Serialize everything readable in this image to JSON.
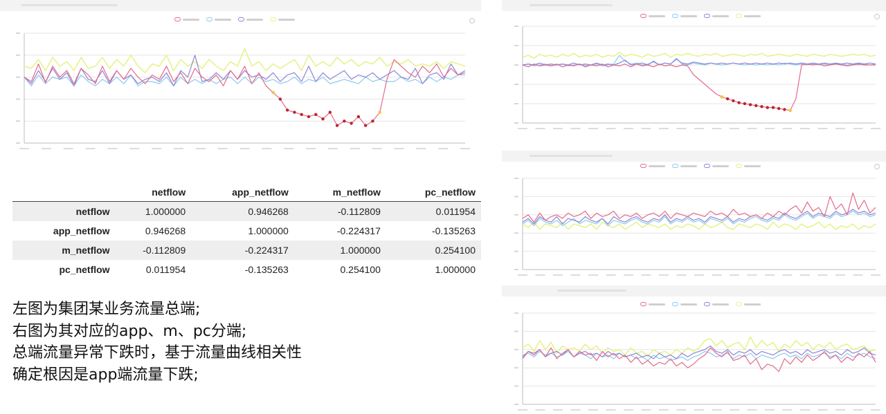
{
  "colors": {
    "series": [
      "#e36a8a",
      "#8ec8ee",
      "#8a86d6",
      "#e6f28c"
    ],
    "anomaly_marker": "#b7262b",
    "transition_marker": "#f3c54b",
    "grid": "#e6e6e6",
    "axis": "#bbbbbb"
  },
  "table": {
    "columns": [
      "",
      "netflow",
      "app_netflow",
      "m_netflow",
      "pc_netflow"
    ],
    "rows": [
      {
        "name": "netflow",
        "values": [
          "1.000000",
          "0.946268",
          "-0.112809",
          "0.011954"
        ]
      },
      {
        "name": "app_netflow",
        "values": [
          "0.946268",
          "1.000000",
          "-0.224317",
          "-0.135263"
        ]
      },
      {
        "name": "m_netflow",
        "values": [
          "-0.112809",
          "-0.224317",
          "1.000000",
          "0.254100"
        ]
      },
      {
        "name": "pc_netflow",
        "values": [
          "0.011954",
          "-0.135263",
          "0.254100",
          "1.000000"
        ]
      }
    ]
  },
  "notes": {
    "line1": "左图为集团某业务流量总端;",
    "line2": "右图为其对应的app、m、pc分端;",
    "line3": "总端流量异常下跌时，基于流量曲线相关性",
    "line4": "确定根因是app端流量下跌;"
  },
  "chart_data": [
    {
      "type": "line",
      "series": [
        {
          "values": [
            60,
            56,
            72,
            55,
            70,
            60,
            66,
            54,
            68,
            62,
            54,
            70,
            56,
            66,
            58,
            68,
            60,
            54,
            62,
            58,
            70,
            56,
            64,
            54,
            68,
            60,
            56,
            62,
            52,
            66,
            58,
            70,
            54,
            64,
            52,
            46,
            40,
            30,
            28,
            26,
            24,
            26,
            22,
            28,
            16,
            20,
            18,
            24,
            16,
            20,
            28,
            58,
            76,
            70,
            64,
            60,
            70,
            64,
            72,
            60,
            68,
            62,
            64
          ]
        },
        {
          "values": [
            60,
            52,
            62,
            54,
            60,
            58,
            60,
            52,
            62,
            56,
            52,
            58,
            54,
            60,
            54,
            62,
            52,
            56,
            56,
            54,
            60,
            52,
            60,
            54,
            58,
            54,
            58,
            54,
            58,
            60,
            54,
            60,
            54,
            60,
            56,
            58,
            54,
            56,
            60,
            54,
            58,
            56,
            60,
            54,
            56,
            58,
            56,
            54,
            60,
            56,
            58,
            56,
            56,
            60,
            56,
            58,
            54,
            60,
            56,
            60,
            58,
            62,
            62
          ]
        },
        {
          "values": [
            60,
            54,
            66,
            56,
            68,
            58,
            64,
            52,
            68,
            58,
            56,
            66,
            54,
            66,
            58,
            62,
            54,
            58,
            60,
            56,
            64,
            52,
            66,
            60,
            80,
            56,
            58,
            64,
            58,
            66,
            58,
            66,
            60,
            62,
            58,
            64,
            56,
            62,
            64,
            56,
            70,
            56,
            64,
            58,
            62,
            66,
            58,
            62,
            60,
            64,
            58,
            62,
            66,
            60,
            58,
            68,
            54,
            62,
            64,
            58,
            72,
            62,
            66
          ]
        },
        {
          "values": [
            70,
            68,
            76,
            66,
            78,
            70,
            74,
            66,
            78,
            68,
            70,
            78,
            68,
            76,
            70,
            80,
            70,
            64,
            72,
            70,
            80,
            66,
            76,
            70,
            74,
            68,
            76,
            70,
            66,
            74,
            70,
            86,
            70,
            74,
            66,
            72,
            68,
            72,
            76,
            66,
            80,
            70,
            74,
            70,
            78,
            72,
            76,
            70,
            74,
            72,
            78,
            70,
            74,
            72,
            76,
            70,
            72,
            70,
            74,
            68,
            74,
            72,
            70
          ]
        }
      ],
      "anomaly_segment": {
        "from_index": 35,
        "to_index": 50
      },
      "ylim": [
        0,
        100
      ]
    },
    {
      "type": "line",
      "series": [
        {
          "values": [
            60,
            58,
            61,
            59,
            60,
            59,
            61,
            58,
            60,
            59,
            61,
            58,
            60,
            59,
            61,
            58,
            60,
            59,
            61,
            58,
            61,
            59,
            60,
            58,
            61,
            59,
            60,
            58,
            60,
            59,
            50,
            45,
            40,
            35,
            30,
            27,
            25,
            23,
            21,
            20,
            19,
            18,
            17,
            16,
            16,
            15,
            14,
            13,
            25,
            60,
            61,
            60,
            61,
            59,
            60,
            61,
            60,
            59,
            60,
            61,
            60,
            60,
            60
          ]
        },
        {
          "values": [
            60,
            61,
            59,
            60,
            61,
            59,
            60,
            61,
            59,
            60,
            61,
            59,
            60,
            61,
            59,
            60,
            61,
            70,
            64,
            61,
            62,
            60,
            61,
            63,
            60,
            62,
            61,
            67,
            61,
            60,
            62,
            61,
            60,
            62,
            61,
            60,
            61,
            62,
            61,
            60,
            61,
            60,
            61,
            60,
            61,
            60,
            62,
            61,
            60,
            61,
            60,
            61,
            60,
            61,
            60,
            61,
            61,
            60,
            61,
            60,
            61,
            60,
            61
          ]
        },
        {
          "values": [
            60,
            61,
            60,
            62,
            60,
            61,
            60,
            61,
            60,
            62,
            60,
            61,
            60,
            62,
            60,
            61,
            60,
            62,
            65,
            60,
            61,
            62,
            60,
            64,
            60,
            62,
            61,
            66,
            62,
            61,
            63,
            62,
            61,
            62,
            61,
            62,
            61,
            62,
            61,
            62,
            61,
            62,
            61,
            62,
            61,
            62,
            61,
            62,
            61,
            62,
            61,
            62,
            61,
            62,
            61,
            62,
            61,
            62,
            61,
            62,
            61,
            62,
            61
          ]
        },
        {
          "values": [
            68,
            70,
            67,
            71,
            69,
            70,
            68,
            71,
            69,
            72,
            68,
            70,
            69,
            71,
            68,
            70,
            69,
            73,
            69,
            71,
            70,
            68,
            71,
            69,
            70,
            72,
            68,
            71,
            70,
            72,
            70,
            69,
            71,
            70,
            72,
            69,
            70,
            71,
            70,
            69,
            71,
            70,
            72,
            69,
            70,
            71,
            70,
            69,
            71,
            70,
            69,
            71,
            70,
            69,
            71,
            70,
            69,
            70,
            71,
            70,
            71,
            69,
            70
          ]
        }
      ],
      "anomaly_segment": {
        "from_index": 35,
        "to_index": 47
      },
      "ylim": [
        0,
        100
      ]
    },
    {
      "type": "line",
      "series": [
        {
          "values": [
            56,
            60,
            52,
            62,
            54,
            58,
            60,
            56,
            62,
            58,
            60,
            64,
            56,
            62,
            58,
            60,
            64,
            56,
            60,
            58,
            62,
            56,
            60,
            62,
            58,
            64,
            56,
            62,
            60,
            58,
            62,
            60,
            58,
            64,
            60,
            62,
            58,
            66,
            60,
            62,
            58,
            60,
            56,
            62,
            58,
            64,
            60,
            66,
            70,
            62,
            74,
            64,
            68,
            58,
            80,
            66,
            72,
            60,
            84,
            66,
            76,
            62,
            68
          ]
        },
        {
          "values": [
            50,
            54,
            48,
            56,
            52,
            50,
            54,
            48,
            52,
            56,
            50,
            54,
            52,
            50,
            56,
            48,
            54,
            52,
            50,
            54,
            56,
            52,
            50,
            54,
            52,
            58,
            50,
            54,
            52,
            56,
            52,
            54,
            50,
            56,
            54,
            52,
            56,
            50,
            54,
            52,
            56,
            58,
            54,
            52,
            56,
            54,
            60,
            56,
            54,
            58,
            62,
            56,
            60,
            58,
            56,
            62,
            58,
            60,
            64,
            60,
            62,
            58,
            60
          ]
        },
        {
          "values": [
            52,
            56,
            50,
            58,
            54,
            52,
            58,
            50,
            56,
            54,
            52,
            58,
            54,
            52,
            56,
            50,
            58,
            54,
            52,
            56,
            58,
            54,
            52,
            56,
            54,
            60,
            52,
            56,
            54,
            58,
            54,
            56,
            52,
            58,
            56,
            54,
            58,
            52,
            56,
            54,
            58,
            60,
            56,
            54,
            58,
            56,
            62,
            58,
            56,
            60,
            64,
            58,
            62,
            60,
            58,
            64,
            60,
            62,
            66,
            62,
            64,
            60,
            62
          ]
        },
        {
          "values": [
            50,
            46,
            52,
            44,
            50,
            48,
            46,
            52,
            44,
            50,
            48,
            46,
            50,
            44,
            52,
            48,
            46,
            50,
            44,
            48,
            52,
            46,
            50,
            48,
            46,
            50,
            44,
            48,
            46,
            50,
            48,
            44,
            50,
            46,
            48,
            52,
            46,
            44,
            50,
            48,
            46,
            50,
            48,
            44,
            52,
            46,
            50,
            48,
            44,
            50,
            46,
            48,
            52,
            46,
            50,
            44,
            48,
            46,
            50,
            44,
            48,
            46,
            50
          ]
        }
      ],
      "ylim": [
        0,
        100
      ]
    },
    {
      "type": "line",
      "series": [
        {
          "values": [
            50,
            58,
            54,
            60,
            52,
            62,
            50,
            56,
            60,
            52,
            58,
            54,
            56,
            48,
            58,
            52,
            56,
            50,
            54,
            46,
            52,
            44,
            48,
            42,
            46,
            44,
            50,
            42,
            46,
            40,
            44,
            50,
            54,
            62,
            56,
            52,
            58,
            48,
            50,
            54,
            44,
            50,
            38,
            44,
            42,
            36,
            50,
            44,
            52,
            46,
            54,
            48,
            52,
            58,
            50,
            54,
            46,
            52,
            48,
            56,
            52,
            58,
            46
          ]
        },
        {
          "values": [
            54,
            56,
            52,
            58,
            54,
            56,
            52,
            54,
            58,
            52,
            56,
            54,
            50,
            56,
            52,
            54,
            50,
            56,
            52,
            54,
            50,
            52,
            48,
            54,
            50,
            52,
            48,
            50,
            52,
            48,
            52,
            54,
            58,
            56,
            52,
            54,
            56,
            50,
            54,
            52,
            56,
            50,
            54,
            52,
            50,
            54,
            56,
            52,
            54,
            50,
            56,
            52,
            54,
            56,
            52,
            54,
            50,
            56,
            52,
            54,
            56,
            52,
            50
          ]
        },
        {
          "values": [
            52,
            58,
            56,
            60,
            52,
            56,
            58,
            54,
            60,
            52,
            56,
            58,
            54,
            56,
            52,
            58,
            54,
            56,
            52,
            54,
            56,
            52,
            54,
            50,
            56,
            52,
            54,
            50,
            56,
            52,
            56,
            58,
            60,
            64,
            58,
            56,
            60,
            54,
            58,
            56,
            60,
            54,
            58,
            56,
            54,
            58,
            60,
            56,
            58,
            54,
            60,
            56,
            58,
            60,
            56,
            58,
            54,
            60,
            56,
            58,
            62,
            56,
            54
          ]
        },
        {
          "values": [
            62,
            66,
            58,
            70,
            60,
            68,
            56,
            64,
            60,
            62,
            58,
            66,
            60,
            64,
            56,
            62,
            58,
            60,
            54,
            62,
            56,
            58,
            52,
            60,
            56,
            58,
            54,
            60,
            56,
            62,
            58,
            62,
            70,
            72,
            64,
            70,
            62,
            66,
            68,
            60,
            74,
            62,
            70,
            64,
            68,
            58,
            66,
            62,
            70,
            64,
            68,
            60,
            66,
            62,
            68,
            60,
            64,
            66,
            60,
            62,
            64,
            58,
            60
          ]
        }
      ],
      "ylim": [
        0,
        100
      ]
    }
  ]
}
